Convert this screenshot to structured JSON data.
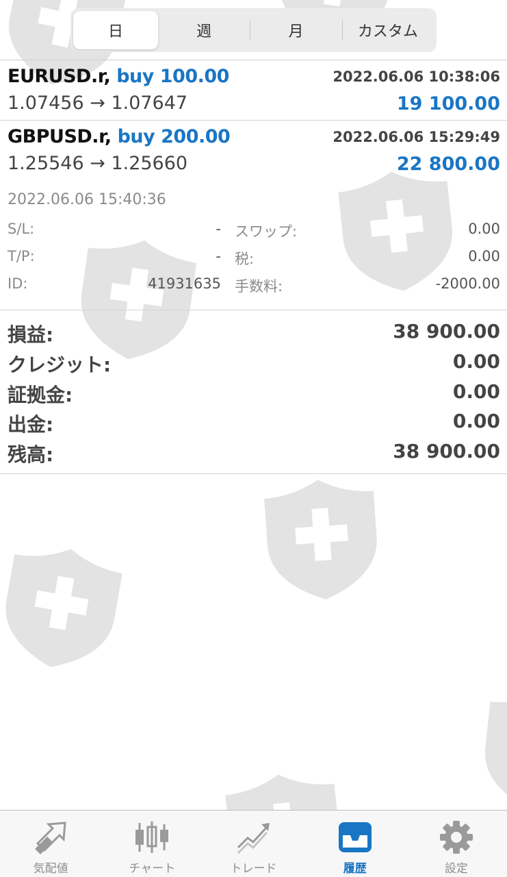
{
  "segments": {
    "items": [
      "日",
      "週",
      "月",
      "カスタム"
    ],
    "active": "日"
  },
  "trades": [
    {
      "symbol": "EURUSD.r,",
      "direction": "buy 100.00",
      "time": "2022.06.06 10:38:06",
      "prices": "1.07456 → 1.07647",
      "profit": "19 100.00"
    },
    {
      "symbol": "GBPUSD.r,",
      "direction": "buy 200.00",
      "time": "2022.06.06 15:29:49",
      "prices": "1.25546 → 1.25660",
      "profit": "22 800.00",
      "close_time": "2022.06.06 15:40:36",
      "details": {
        "sl_label": "S/L:",
        "sl_value": "-",
        "tp_label": "T/P:",
        "tp_value": "-",
        "id_label": "ID:",
        "id_value": "41931635",
        "swap_label": "スワップ:",
        "swap_value": "0.00",
        "tax_label": "税:",
        "tax_value": "0.00",
        "commission_label": "手数料:",
        "commission_value": "-2000.00"
      }
    }
  ],
  "summary": [
    {
      "label": "損益:",
      "value": "38 900.00"
    },
    {
      "label": "クレジット:",
      "value": "0.00"
    },
    {
      "label": "証拠金:",
      "value": "0.00"
    },
    {
      "label": "出金:",
      "value": "0.00"
    },
    {
      "label": "残高:",
      "value": "38 900.00"
    }
  ],
  "tabbar": {
    "items": [
      {
        "label": "気配値",
        "icon": "quotes-icon"
      },
      {
        "label": "チャート",
        "icon": "chart-icon"
      },
      {
        "label": "トレード",
        "icon": "trade-icon"
      },
      {
        "label": "履歴",
        "icon": "history-icon"
      },
      {
        "label": "設定",
        "icon": "settings-icon"
      }
    ],
    "active": "履歴"
  },
  "colors": {
    "accent": "#1a76c4",
    "text": "#2b2b2b",
    "muted": "#8a8a8a",
    "watermark": "#e2e2e2"
  }
}
